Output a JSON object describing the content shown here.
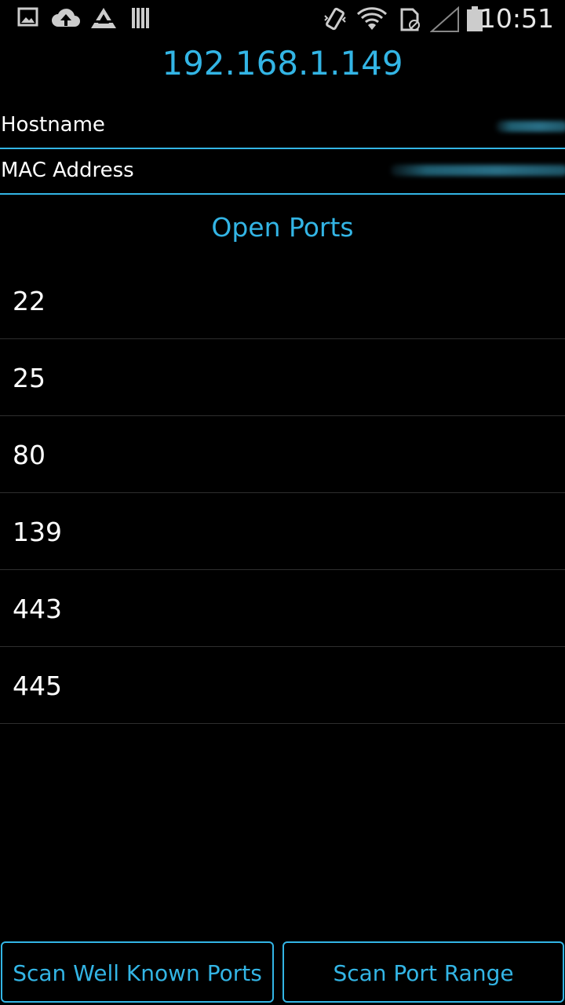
{
  "status_bar": {
    "time": "10:51",
    "icons": [
      "gallery-icon",
      "cloud-upload-icon",
      "app-icon",
      "barcode-icon",
      "vibrate-icon",
      "wifi-icon",
      "sim-icon",
      "signal-icon",
      "battery-icon"
    ]
  },
  "host": {
    "ip": "192.168.1.149",
    "hostname_label": "Hostname",
    "mac_label": "MAC Address"
  },
  "ports": {
    "title": "Open Ports",
    "items": [
      "22",
      "25",
      "80",
      "139",
      "443",
      "445"
    ]
  },
  "buttons": {
    "scan_well_known": "Scan Well Known Ports",
    "scan_range": "Scan Port Range"
  },
  "colors": {
    "accent": "#33b5e5",
    "background": "#000000"
  }
}
